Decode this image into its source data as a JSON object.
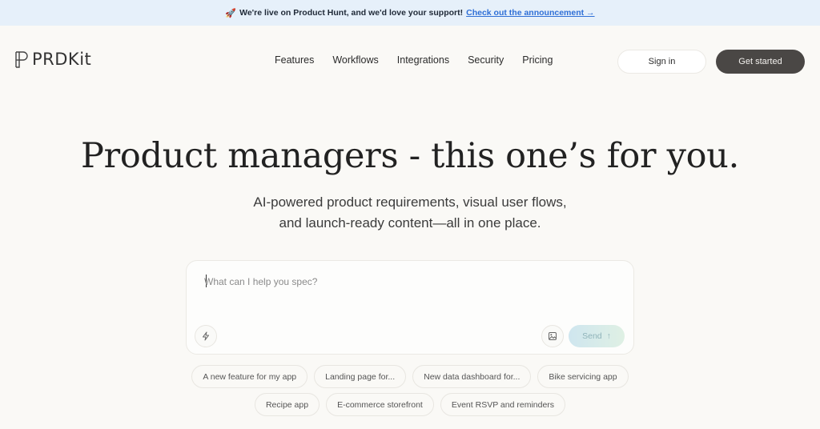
{
  "announcement": {
    "rocket": "🚀",
    "text": "We're live on Product Hunt, and we'd love your support!",
    "link": "Check out the announcement →"
  },
  "nav": {
    "logo": "PRDKit",
    "links": [
      "Features",
      "Workflows",
      "Integrations",
      "Security",
      "Pricing"
    ],
    "sign_in": "Sign in",
    "get_started": "Get started"
  },
  "hero": {
    "title": "Product managers - this one’s for you.",
    "subtitle_line1": "AI-powered product requirements, visual user flows,",
    "subtitle_line2": "and launch-ready content—all in one place."
  },
  "prompt": {
    "placeholder": "What can I help you spec?",
    "send_label": "Send",
    "send_arrow": "↑"
  },
  "suggestions": {
    "row1": [
      "A new feature for my app",
      "Landing page for...",
      "New data dashboard for...",
      "Bike servicing app"
    ],
    "row2": [
      "Recipe app",
      "E-commerce storefront",
      "Event RSVP and reminders"
    ]
  },
  "colors": {
    "background": "#faf9f6",
    "banner": "#e6f0fa",
    "link": "#2f6fd6",
    "primary_button": "#4a4745"
  }
}
